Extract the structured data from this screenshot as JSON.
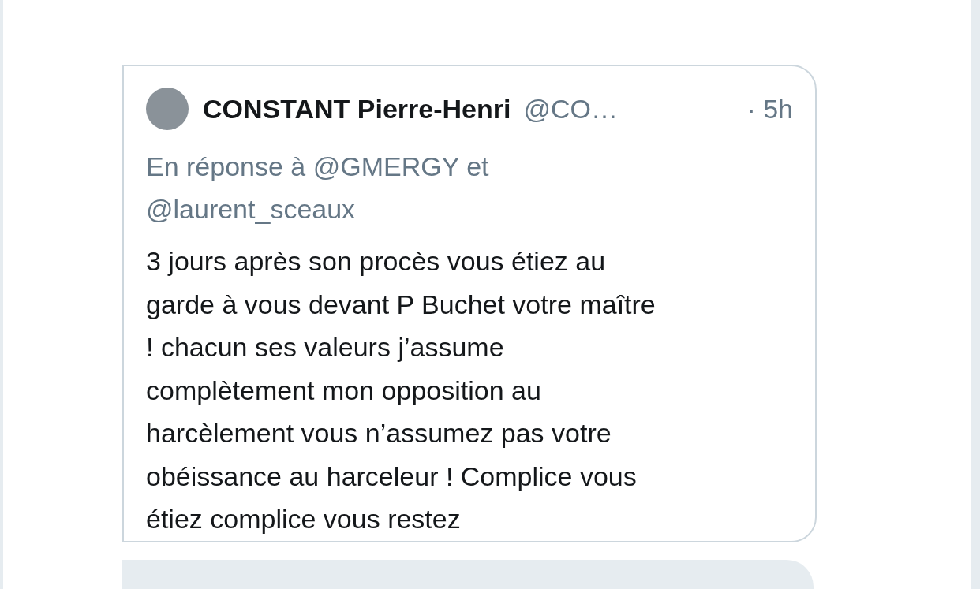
{
  "quoted_tweet": {
    "author_name": "CONSTANT Pierre-Henri",
    "handle": "@CO…",
    "time": "· 5h",
    "reply_to": "En réponse à @GMERGY  et @laurent_sceaux",
    "text": "3 jours après son procès vous étiez au\ngarde à vous devant P Buchet votre maître\n! chacun ses valeurs j’assume\ncomplètement mon opposition au\nharcèlement vous n’assumez pas votre\nobéissance au harceleur ! Complice vous\nétiez complice vous restez"
  }
}
